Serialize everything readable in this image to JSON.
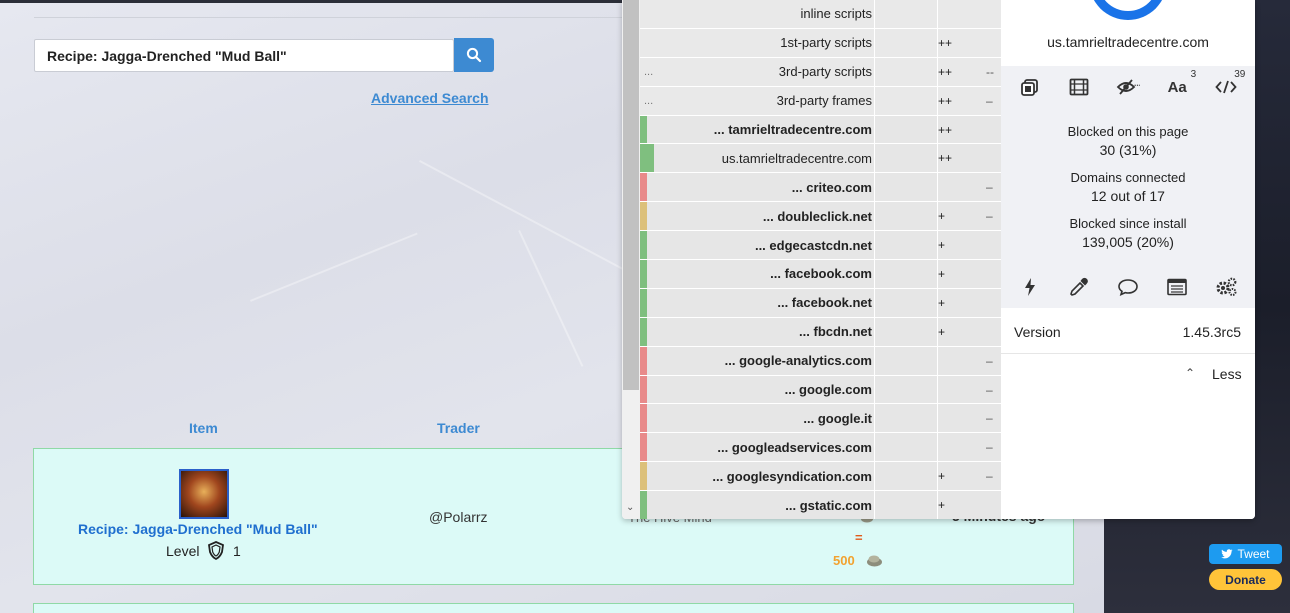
{
  "page": {
    "search_value": "Recipe: Jagga-Drenched \"Mud Ball\"",
    "advanced_search": "Advanced Search",
    "columns": {
      "item": "Item",
      "trader": "Trader"
    },
    "result": {
      "item_name": "Recipe: Jagga-Drenched \"Mud Ball\"",
      "level_label": "Level",
      "level_value": "1",
      "trader": "@Polarrz",
      "guild": "The Hive Mind",
      "time": "5 Minutes ago",
      "equals": "=",
      "total_price": "500"
    },
    "tweet": "Tweet",
    "donate": "Donate"
  },
  "ublock": {
    "rows": [
      {
        "host": "inline scripts",
        "bold": false,
        "dots": "",
        "c1": "",
        "c2": "",
        "bar": ""
      },
      {
        "host": "1st-party scripts",
        "bold": false,
        "dots": "",
        "c1": "++",
        "c2": "",
        "bar": ""
      },
      {
        "host": "3rd-party scripts",
        "bold": false,
        "dots": "...",
        "c1": "++",
        "c2": "--",
        "bar": ""
      },
      {
        "host": "3rd-party frames",
        "bold": false,
        "dots": "...",
        "c1": "++",
        "c2": "–",
        "bar": ""
      },
      {
        "host": "... tamrieltradecentre.com",
        "bold": true,
        "dots": "",
        "c1": "++",
        "c2": "",
        "bar": "#7fbf7f"
      },
      {
        "host": "us.tamrieltradecentre.com",
        "bold": false,
        "dots": "",
        "c1": "++",
        "c2": "",
        "bar": "#7fbf7f"
      },
      {
        "host": "... criteo.com",
        "bold": true,
        "dots": "",
        "c1": "",
        "c2": "–",
        "bar": "#e88a8a"
      },
      {
        "host": "... doubleclick.net",
        "bold": true,
        "dots": "",
        "c1": "+",
        "c2": "–",
        "bar": "#dcc07a"
      },
      {
        "host": "... edgecastcdn.net",
        "bold": true,
        "dots": "",
        "c1": "+",
        "c2": "",
        "bar": "#7fbf7f"
      },
      {
        "host": "... facebook.com",
        "bold": true,
        "dots": "",
        "c1": "+",
        "c2": "",
        "bar": "#7fbf7f"
      },
      {
        "host": "... facebook.net",
        "bold": true,
        "dots": "",
        "c1": "+",
        "c2": "",
        "bar": "#7fbf7f"
      },
      {
        "host": "... fbcdn.net",
        "bold": true,
        "dots": "",
        "c1": "+",
        "c2": "",
        "bar": "#7fbf7f"
      },
      {
        "host": "... google-analytics.com",
        "bold": true,
        "dots": "",
        "c1": "",
        "c2": "–",
        "bar": "#e88a8a"
      },
      {
        "host": "... google.com",
        "bold": true,
        "dots": "",
        "c1": "",
        "c2": "–",
        "bar": "#e88a8a"
      },
      {
        "host": "... google.it",
        "bold": true,
        "dots": "",
        "c1": "",
        "c2": "–",
        "bar": "#e88a8a"
      },
      {
        "host": "... googleadservices.com",
        "bold": true,
        "dots": "",
        "c1": "",
        "c2": "–",
        "bar": "#e88a8a"
      },
      {
        "host": "... googlesyndication.com",
        "bold": true,
        "dots": "",
        "c1": "+",
        "c2": "–",
        "bar": "#dcc07a"
      },
      {
        "host": "... gstatic.com",
        "bold": true,
        "dots": "",
        "c1": "+",
        "c2": "",
        "bar": "#7fbf7f"
      }
    ],
    "hostname": "us.tamrieltradecentre.com",
    "tools_top": {
      "fonts_sup": "3",
      "scripts_sup": "39",
      "fonts_label": "Aa"
    },
    "stats": {
      "blocked_page_label": "Blocked on this page",
      "blocked_page_value": "30 (31%)",
      "domains_label": "Domains connected",
      "domains_value": "12 out of 17",
      "blocked_install_label": "Blocked since install",
      "blocked_install_value": "139,005 (20%)"
    },
    "version_label": "Version",
    "version_value": "1.45.3rc5",
    "less_label": "Less",
    "colors": {
      "accent": "#1a73e8",
      "allowed": "#7fbf7f",
      "blocked": "#e88a8a",
      "partial": "#dcc07a"
    }
  }
}
